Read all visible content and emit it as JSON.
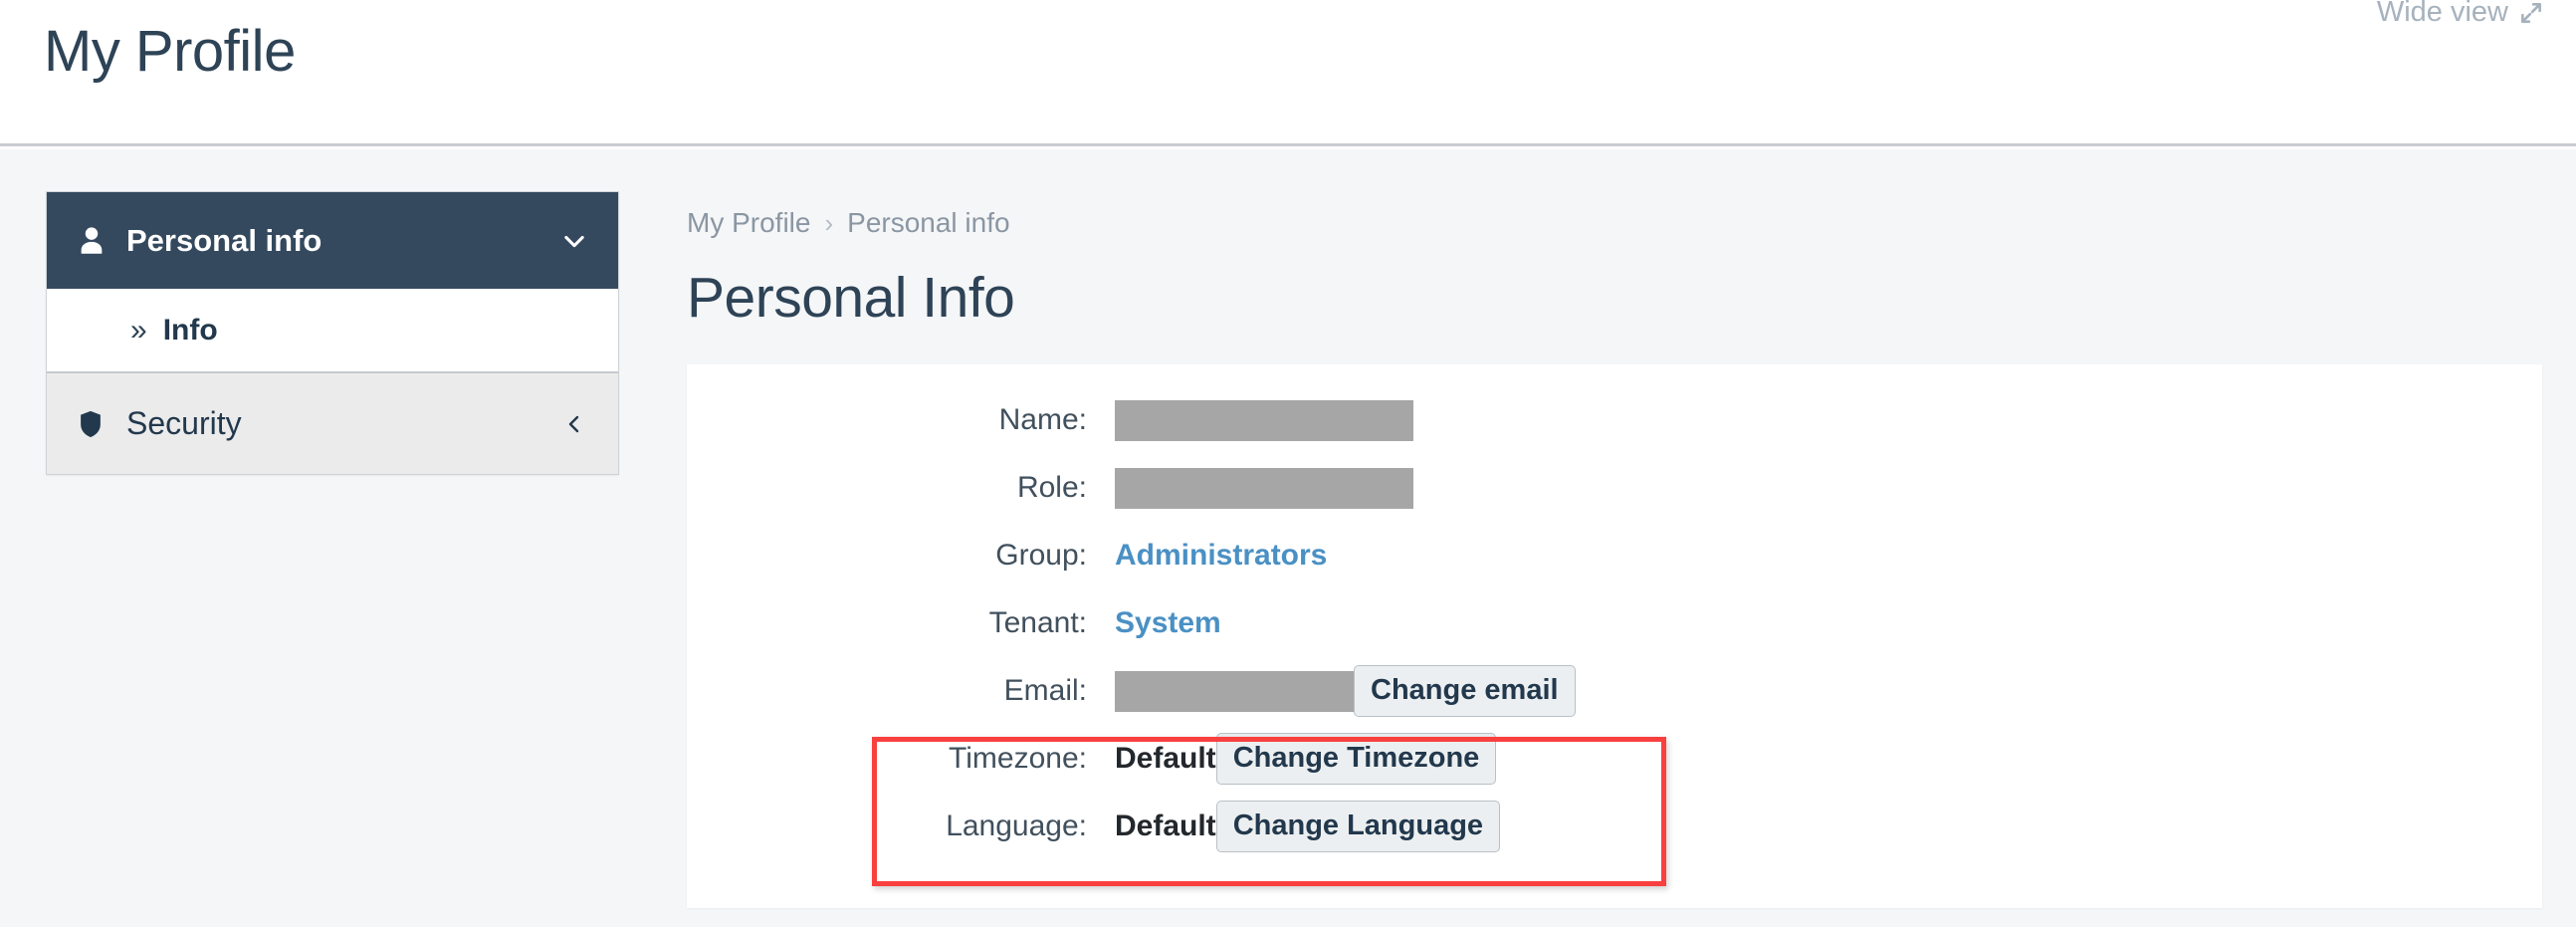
{
  "header": {
    "title": "My Profile",
    "wide_view_label": "Wide view",
    "wide_view_icon": "expand-arrows-icon"
  },
  "sidebar": {
    "sections": [
      {
        "label": "Personal info",
        "icon": "user-icon",
        "chevron": "chevron-down-icon",
        "expanded": true,
        "active": true,
        "subitems": [
          {
            "label": "Info",
            "bullet": "»",
            "active": true
          }
        ]
      }
    ],
    "items": [
      {
        "label": "Security",
        "icon": "shield-icon",
        "chevron": "chevron-left-icon",
        "expanded": false,
        "active": false
      }
    ]
  },
  "main": {
    "breadcrumb": [
      {
        "label": "My Profile",
        "current": false
      },
      {
        "label": "Personal info",
        "current": true
      }
    ],
    "breadcrumb_separator": "›",
    "title": "Personal Info",
    "form_rows": [
      {
        "label": "Name:",
        "value_type": "redacted",
        "value": "",
        "button": null
      },
      {
        "label": "Role:",
        "value_type": "redacted",
        "value": "",
        "button": null
      },
      {
        "label": "Group:",
        "value_type": "link",
        "value": "Administrators",
        "button": null
      },
      {
        "label": "Tenant:",
        "value_type": "link",
        "value": "System",
        "button": null
      },
      {
        "label": "Email:",
        "value_type": "redacted",
        "value": "",
        "button": "Change email"
      },
      {
        "label": "Timezone:",
        "value_type": "bold",
        "value": "Default",
        "button": "Change Timezone"
      },
      {
        "label": "Language:",
        "value_type": "bold",
        "value": "Default",
        "button": "Change Language"
      }
    ]
  },
  "colors": {
    "sidebar_active_bg": "#34495e",
    "heading": "#2e4356",
    "link": "#4a90c4",
    "page_bg": "#f5f6f8",
    "redaction": "#a6a6a6",
    "highlight": "#f8403f"
  }
}
